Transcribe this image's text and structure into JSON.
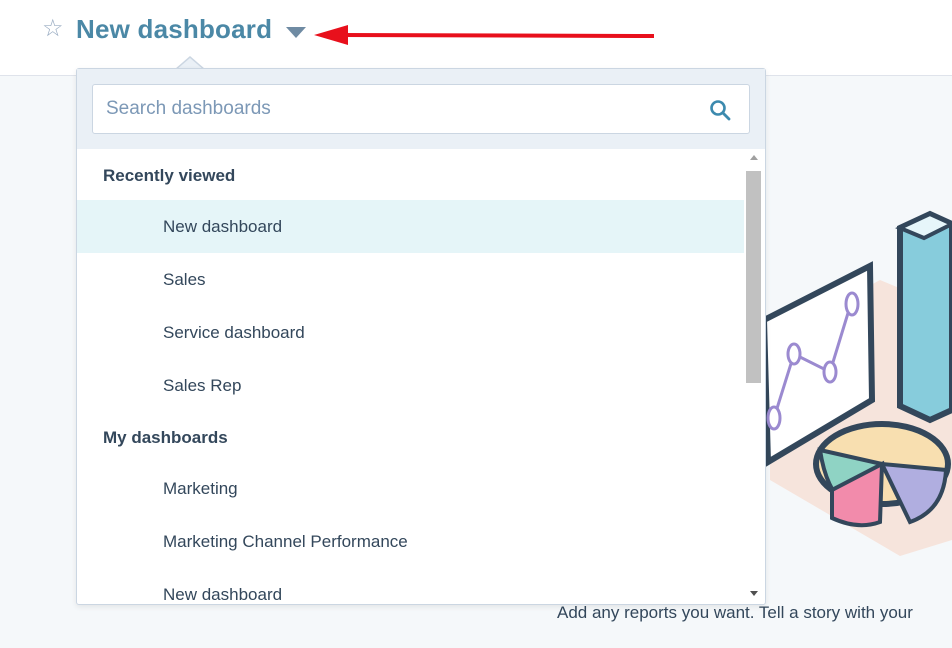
{
  "header": {
    "title": "New dashboard",
    "star_icon": "star-outline-icon",
    "caret_icon": "caret-down-icon"
  },
  "dropdown": {
    "search": {
      "placeholder": "Search dashboards",
      "value": ""
    },
    "sections": [
      {
        "heading": "Recently viewed",
        "items": [
          "New dashboard",
          "Sales",
          "Service dashboard",
          "Sales Rep"
        ]
      },
      {
        "heading": "My dashboards",
        "items": [
          "Marketing",
          "Marketing Channel Performance",
          "New dashboard"
        ]
      }
    ]
  },
  "footer_text": "Add any reports you want. Tell a story with your",
  "colors": {
    "title": "#4b88a6",
    "active_item_bg": "#e5f5f8",
    "annotation_arrow": "#e8101c"
  }
}
